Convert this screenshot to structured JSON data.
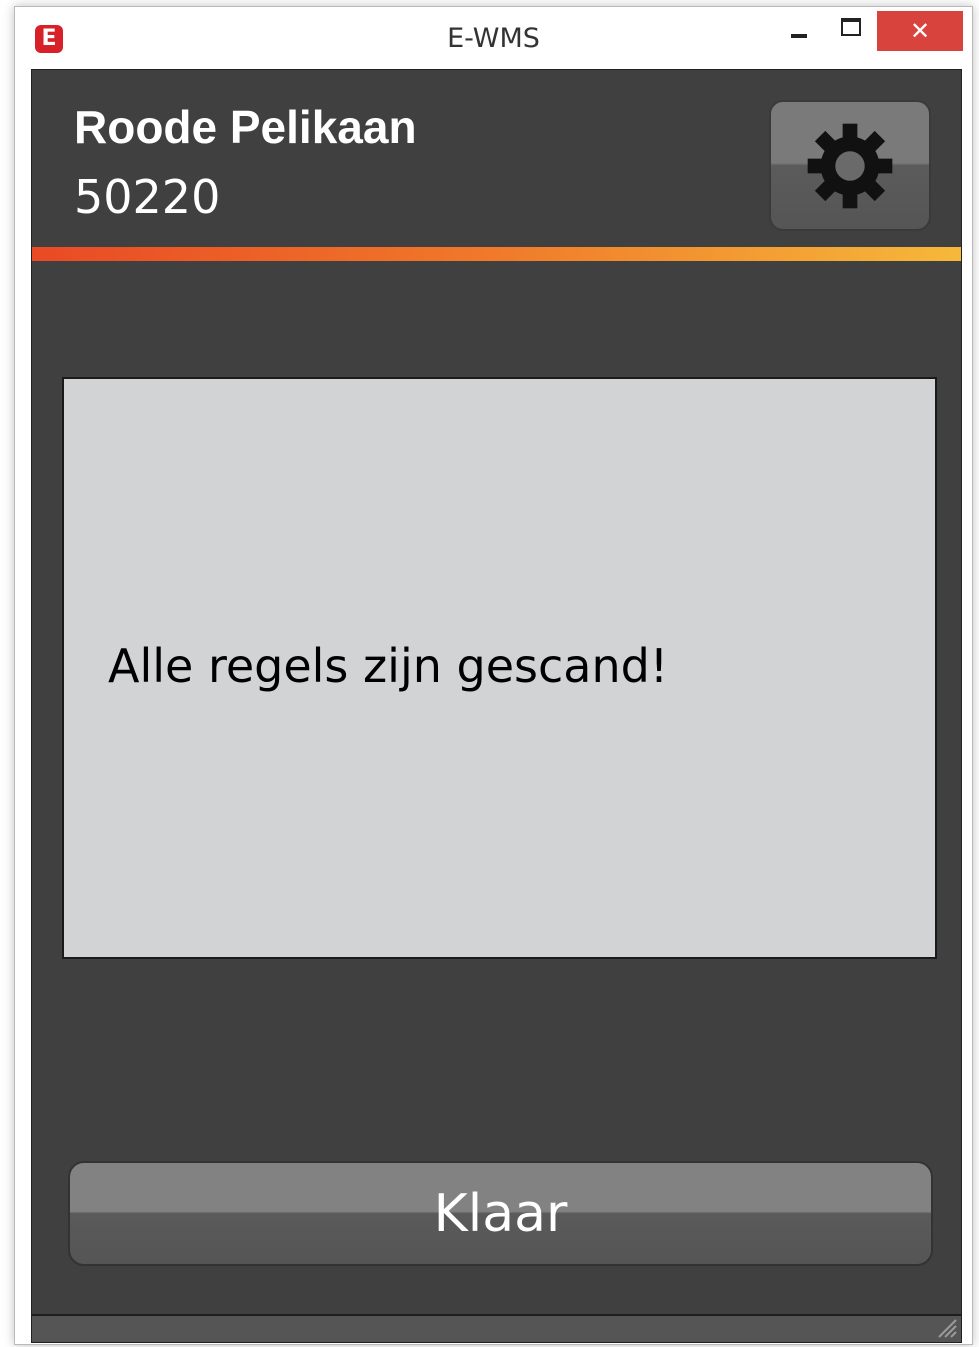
{
  "window": {
    "title": "E-WMS",
    "app_icon_letter": "E",
    "close_glyph": "✕"
  },
  "header": {
    "name": "Roode Pelikaan",
    "code": "50220",
    "settings_icon": "gear-icon"
  },
  "colors": {
    "background": "#404040",
    "accent_start": "#e94a24",
    "accent_end": "#f6b83a",
    "message_bg": "#d2d3d5",
    "close_button": "#d9433d"
  },
  "message": {
    "text": "Alle regels zijn gescand!"
  },
  "actions": {
    "done_label": "Klaar"
  }
}
